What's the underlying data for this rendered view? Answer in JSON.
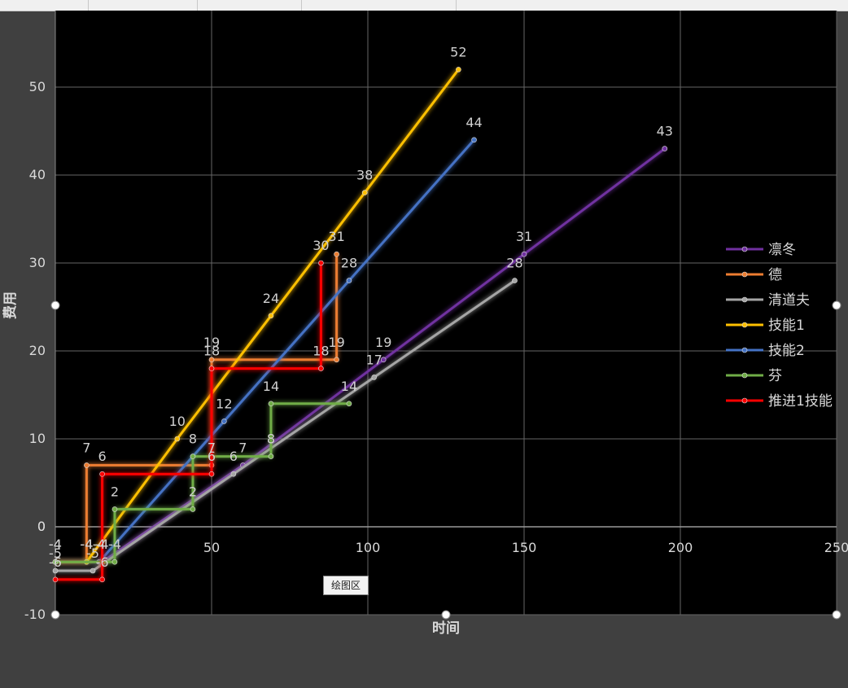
{
  "tooltip": "绘图区",
  "chart_data": {
    "type": "line",
    "xlabel": "时间",
    "ylabel": "费用",
    "xlim": [
      0,
      250
    ],
    "ylim": [
      -10,
      60
    ],
    "xticks": [
      50,
      100,
      150,
      200,
      250
    ],
    "yticks": [
      -10,
      0,
      10,
      20,
      30,
      40,
      50
    ],
    "grid": true,
    "legend_position": "right",
    "series": [
      {
        "name": "凛冬",
        "color": "#7030a0",
        "x": [
          0,
          15,
          60,
          105,
          150,
          195
        ],
        "y": [
          -4,
          -4,
          7,
          19,
          31,
          43
        ],
        "labels": [
          -4,
          -4,
          7,
          19,
          31,
          43
        ]
      },
      {
        "name": "德",
        "color": "#ed7d31",
        "x": [
          0,
          10,
          10,
          50,
          50,
          90,
          90
        ],
        "y": [
          -4,
          -4,
          7,
          7,
          19,
          19,
          31
        ],
        "labels": [
          -4,
          -4,
          7,
          7,
          19,
          19,
          31
        ]
      },
      {
        "name": "清道夫",
        "color": "#a5a5a5",
        "x": [
          0,
          12,
          57,
          102,
          147
        ],
        "y": [
          -5,
          -5,
          6,
          17,
          28
        ],
        "labels": [
          -5,
          -5,
          6,
          17,
          28
        ]
      },
      {
        "name": "技能1",
        "color": "#ffc000",
        "x": [
          10,
          39,
          69,
          99,
          129
        ],
        "y": [
          -4,
          10,
          24,
          38,
          52
        ],
        "labels": [
          -4,
          10,
          24,
          38,
          52
        ]
      },
      {
        "name": "技能2",
        "color": "#4472c4",
        "x": [
          14,
          54,
          94,
          134
        ],
        "y": [
          -4,
          12,
          28,
          44
        ],
        "labels": [
          -4,
          12,
          28,
          44
        ]
      },
      {
        "name": "芬",
        "color": "#70ad47",
        "x": [
          0,
          19,
          19,
          44,
          44,
          69,
          69,
          94
        ],
        "y": [
          -4,
          -4,
          2,
          2,
          8,
          8,
          14,
          14
        ],
        "labels": [
          -4,
          -4,
          2,
          2,
          8,
          8,
          14,
          14
        ]
      },
      {
        "name": "推进1技能",
        "color": "#ff0000",
        "x": [
          0,
          15,
          15,
          50,
          50,
          85,
          85
        ],
        "y": [
          -6,
          -6,
          6,
          6,
          18,
          18,
          30
        ],
        "labels": [
          -6,
          -6,
          6,
          6,
          18,
          18,
          30
        ]
      }
    ]
  }
}
